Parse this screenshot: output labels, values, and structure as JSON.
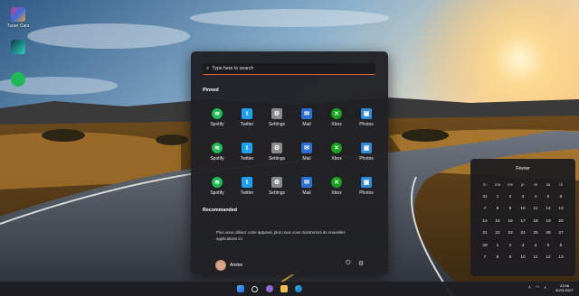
{
  "desktop": {
    "icons": [
      {
        "label": "Tuner Cars",
        "icon": "tuner-cars-app-icon"
      },
      {
        "label": "",
        "icon": "edge-dark-app-icon"
      },
      {
        "label": "",
        "icon": "spotify-icon"
      }
    ]
  },
  "start_menu": {
    "search_placeholder": "Type here to search",
    "pinned_title": "Pinned",
    "pinned": [
      {
        "label": "Spotify",
        "icon": "spotify-icon",
        "color": "#1db954"
      },
      {
        "label": "Twitter",
        "icon": "twitter-icon",
        "color": "#1da1f2"
      },
      {
        "label": "Settings",
        "icon": "gear-icon",
        "color": "#8a8a8a"
      },
      {
        "label": "Mail",
        "icon": "mail-icon",
        "color": "#2a6fd6"
      },
      {
        "label": "Xbox",
        "icon": "xbox-icon",
        "color": "#16a31a"
      },
      {
        "label": "Photos",
        "icon": "photos-icon",
        "color": "#2d8ad8"
      },
      {
        "label": "Spotify",
        "icon": "spotify-icon",
        "color": "#1db954"
      },
      {
        "label": "Twitter",
        "icon": "twitter-icon",
        "color": "#1da1f2"
      },
      {
        "label": "Settings",
        "icon": "gear-icon",
        "color": "#8a8a8a"
      },
      {
        "label": "Mail",
        "icon": "mail-icon",
        "color": "#2a6fd6"
      },
      {
        "label": "Xbox",
        "icon": "xbox-icon",
        "color": "#16a31a"
      },
      {
        "label": "Photos",
        "icon": "photos-icon",
        "color": "#2d8ad8"
      },
      {
        "label": "Spotify",
        "icon": "spotify-icon",
        "color": "#1db954"
      },
      {
        "label": "Twitter",
        "icon": "twitter-icon",
        "color": "#1da1f2"
      },
      {
        "label": "Settings",
        "icon": "gear-icon",
        "color": "#8a8a8a"
      },
      {
        "label": "Mail",
        "icon": "mail-icon",
        "color": "#2a6fd6"
      },
      {
        "label": "Xbox",
        "icon": "xbox-icon",
        "color": "#16a31a"
      },
      {
        "label": "Photos",
        "icon": "photos-icon",
        "color": "#2d8ad8"
      }
    ],
    "recommended_title": "Recommanded",
    "recommended_text": "Plus vous utilisez votre appareil, plus nous vous montrerons de nouvelles applications ici.",
    "user_name": "Amine"
  },
  "calendar": {
    "month": "Février",
    "weekdays": [
      "lu",
      "ma",
      "me",
      "je",
      "ve",
      "sa",
      "di"
    ],
    "days": [
      "31",
      "1",
      "2",
      "3",
      "4",
      "5",
      "6",
      "7",
      "8",
      "9",
      "10",
      "11",
      "12",
      "13",
      "14",
      "15",
      "16",
      "17",
      "18",
      "19",
      "20",
      "21",
      "22",
      "23",
      "24",
      "25",
      "26",
      "27",
      "28",
      "1",
      "2",
      "3",
      "4",
      "5",
      "6",
      "7",
      "8",
      "9",
      "10",
      "11",
      "12",
      "13"
    ]
  },
  "taskbar": {
    "icons": [
      "windows-start-icon",
      "search-icon",
      "chat-icon",
      "file-explorer-icon",
      "edge-icon"
    ],
    "time": "23:56",
    "date": "30/11/2027"
  }
}
